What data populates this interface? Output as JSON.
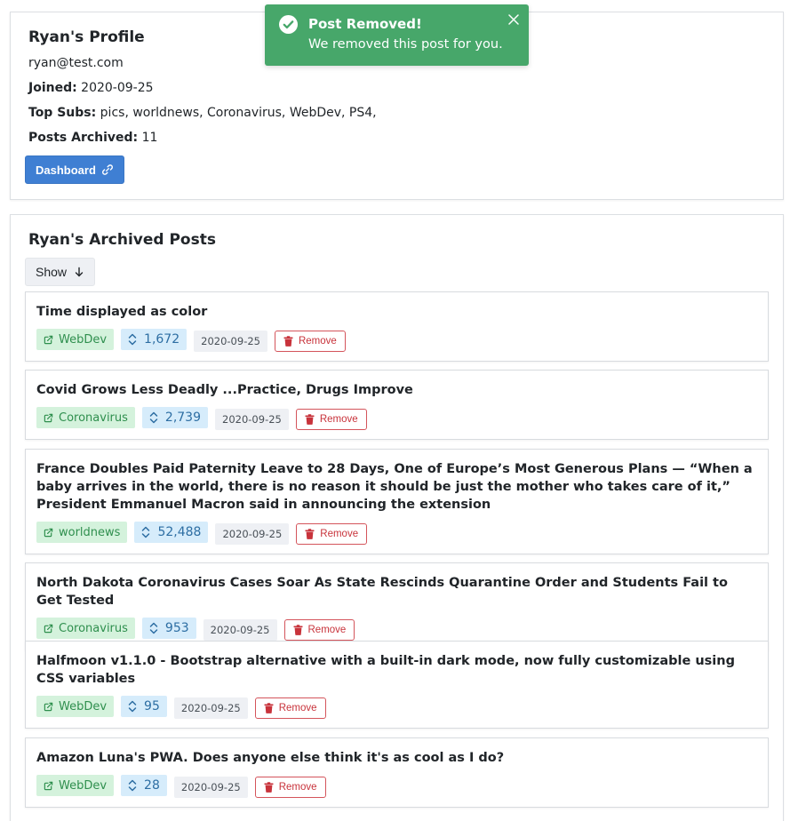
{
  "toast": {
    "title": "Post Removed!",
    "message": "We removed this post for you."
  },
  "profile": {
    "title": "Ryan's Profile",
    "email": "ryan@test.com",
    "joined_label": "Joined:",
    "joined_value": "2020-09-25",
    "top_subs_label": "Top Subs:",
    "top_subs_value": "pics, worldnews, Coronavirus, WebDev, PS4,",
    "posts_archived_label": "Posts Archived:",
    "posts_archived_value": "11",
    "dashboard_label": "Dashboard"
  },
  "archive": {
    "title": "Ryan's Archived Posts",
    "show_label": "Show",
    "remove_label": "Remove",
    "posts": [
      {
        "title": "Time displayed as color",
        "sub": "WebDev",
        "score": "1,672",
        "date": "2020-09-25"
      },
      {
        "title": "Covid Grows Less Deadly ...Practice, Drugs Improve",
        "sub": "Coronavirus",
        "score": "2,739",
        "date": "2020-09-25"
      },
      {
        "title": "France Doubles Paid Paternity Leave to 28 Days, One of Europe’s Most Generous Plans — “When a baby arrives in the world, there is no reason it should be just the mother who takes care of it,” President Emmanuel Macron said in announcing the extension",
        "sub": "worldnews",
        "score": "52,488",
        "date": "2020-09-25"
      },
      {
        "title": "North Dakota Coronavirus Cases Soar As State Rescinds Quarantine Order and Students Fail to Get Tested",
        "sub": "Coronavirus",
        "score": "953",
        "date": "2020-09-25"
      },
      {
        "title": "Halfmoon v1.1.0 - Bootstrap alternative with a built-in dark mode, now fully customizable using CSS variables",
        "sub": "WebDev",
        "score": "95",
        "date": "2020-09-25"
      },
      {
        "title": "Amazon Luna's PWA. Does anyone else think it's as cool as I do?",
        "sub": "WebDev",
        "score": "28",
        "date": "2020-09-25"
      }
    ]
  }
}
